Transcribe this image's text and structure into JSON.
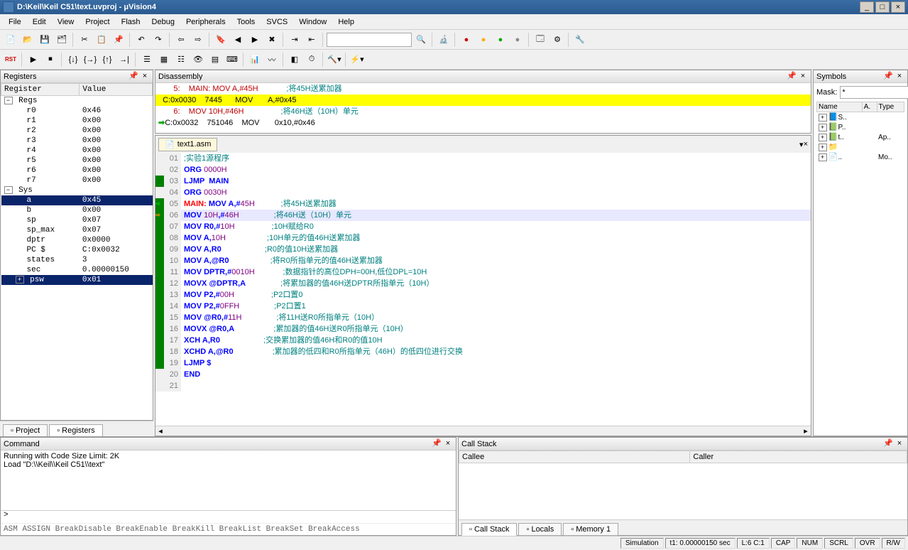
{
  "window": {
    "title": "D:\\Keil\\Keil C51\\text.uvproj - μVision4"
  },
  "menu": [
    "File",
    "Edit",
    "View",
    "Project",
    "Flash",
    "Debug",
    "Peripherals",
    "Tools",
    "SVCS",
    "Window",
    "Help"
  ],
  "panels": {
    "registers": "Registers",
    "disassembly": "Disassembly",
    "symbols": "Symbols",
    "command": "Command",
    "callstack": "Call Stack"
  },
  "registers": {
    "headers": [
      "Register",
      "Value"
    ],
    "groups": [
      {
        "name": "Regs",
        "expanded": true,
        "rows": [
          {
            "name": "r0",
            "value": "0x46"
          },
          {
            "name": "r1",
            "value": "0x00"
          },
          {
            "name": "r2",
            "value": "0x00"
          },
          {
            "name": "r3",
            "value": "0x00"
          },
          {
            "name": "r4",
            "value": "0x00"
          },
          {
            "name": "r5",
            "value": "0x00"
          },
          {
            "name": "r6",
            "value": "0x00"
          },
          {
            "name": "r7",
            "value": "0x00"
          }
        ]
      },
      {
        "name": "Sys",
        "expanded": true,
        "rows": [
          {
            "name": "a",
            "value": "0x45",
            "selected": true
          },
          {
            "name": "b",
            "value": "0x00"
          },
          {
            "name": "sp",
            "value": "0x07"
          },
          {
            "name": "sp_max",
            "value": "0x07"
          },
          {
            "name": "dptr",
            "value": "0x0000"
          },
          {
            "name": "PC $",
            "value": "C:0x0032"
          },
          {
            "name": "states",
            "value": "3"
          },
          {
            "name": "sec",
            "value": "0.00000150"
          },
          {
            "name": "psw",
            "value": "0x01",
            "expandable": true,
            "selected": true
          }
        ]
      }
    ]
  },
  "left_tabs": [
    {
      "label": "Project",
      "icon": "project-icon"
    },
    {
      "label": "Registers",
      "icon": "registers-icon",
      "active": true
    }
  ],
  "disassembly": [
    {
      "addr": "     5:",
      "label": " MAIN: MOV A,#45H",
      "cmt": ";将45H送累加器",
      "red": true
    },
    {
      "addr": "C:0x0030",
      "op": "7445",
      "mn": "MOV",
      "args": "A,#0x45",
      "hl": true
    },
    {
      "addr": "     6:",
      "label": " MOV 10H,#46H",
      "cmt": ";将46H送（10H）单元",
      "red": true
    },
    {
      "addr": "C:0x0032",
      "op": "751046",
      "mn": "MOV",
      "args": "0x10,#0x46",
      "marker": true
    }
  ],
  "editor": {
    "filename": "text1.asm",
    "lines": [
      {
        "n": "01",
        "txt": ";实验1源程序",
        "cmt_all": true,
        "mark": false
      },
      {
        "n": "02",
        "txt_parts": [
          {
            "t": "ORG ",
            "c": "kw"
          },
          {
            "t": "0000H",
            "c": "num"
          }
        ],
        "mark": false
      },
      {
        "n": "03",
        "txt_parts": [
          {
            "t": "LJMP  MAIN",
            "c": "kw"
          }
        ],
        "mark": true
      },
      {
        "n": "04",
        "txt_parts": [
          {
            "t": "ORG ",
            "c": "kw"
          },
          {
            "t": "0030H",
            "c": "num"
          }
        ],
        "mark": false
      },
      {
        "n": "05",
        "txt_parts": [
          {
            "t": "MAIN:",
            "c": "lbl"
          },
          {
            "t": " MOV A,#",
            "c": "kw"
          },
          {
            "t": "45H",
            "c": "num"
          }
        ],
        "cmt": ";将45H送累加器",
        "mark": true,
        "arrow": "green"
      },
      {
        "n": "06",
        "txt_parts": [
          {
            "t": "MOV ",
            "c": "kw"
          },
          {
            "t": "10H",
            "c": "num"
          },
          {
            "t": ",#",
            "c": "kw"
          },
          {
            "t": "46H",
            "c": "num"
          }
        ],
        "cmt": ";将46H送（10H）单元",
        "mark": true,
        "arrow": "yellow",
        "hl": true
      },
      {
        "n": "07",
        "txt_parts": [
          {
            "t": "MOV R0,#",
            "c": "kw"
          },
          {
            "t": "10H",
            "c": "num"
          }
        ],
        "cmt": ";10H赋给R0",
        "mark": true
      },
      {
        "n": "08",
        "txt_parts": [
          {
            "t": "MOV A,",
            "c": "kw"
          },
          {
            "t": "10H",
            "c": "num"
          }
        ],
        "cmt": ";10H单元的值46H送累加器",
        "mark": true
      },
      {
        "n": "09",
        "txt_parts": [
          {
            "t": "MOV A,R0",
            "c": "kw"
          }
        ],
        "cmt": ";R0的值10H送累加器",
        "mark": true
      },
      {
        "n": "10",
        "txt_parts": [
          {
            "t": "MOV A,@R0",
            "c": "kw"
          }
        ],
        "cmt": ";将R0所指单元的值46H送累加器",
        "mark": true
      },
      {
        "n": "11",
        "txt_parts": [
          {
            "t": "MOV DPTR,#",
            "c": "kw"
          },
          {
            "t": "0010H",
            "c": "num"
          }
        ],
        "cmt": ";数据指针的高位DPH=00H,低位DPL=10H",
        "mark": true
      },
      {
        "n": "12",
        "txt_parts": [
          {
            "t": "MOVX @DPTR,A",
            "c": "kw"
          }
        ],
        "cmt": ";将累加器的值46H送DPTR所指单元（10H）",
        "mark": true
      },
      {
        "n": "13",
        "txt_parts": [
          {
            "t": "MOV P2,#",
            "c": "kw"
          },
          {
            "t": "00H",
            "c": "num"
          }
        ],
        "cmt": ";P2口置0",
        "mark": true
      },
      {
        "n": "14",
        "txt_parts": [
          {
            "t": "MOV P2,#",
            "c": "kw"
          },
          {
            "t": "0FFH",
            "c": "num"
          }
        ],
        "cmt": ";P2口置1",
        "mark": true
      },
      {
        "n": "15",
        "txt_parts": [
          {
            "t": "MOV @R0,#",
            "c": "kw"
          },
          {
            "t": "11H",
            "c": "num"
          }
        ],
        "cmt": ";将11H送R0所指单元（10H）",
        "mark": true
      },
      {
        "n": "16",
        "txt_parts": [
          {
            "t": "MOVX @R0,A",
            "c": "kw"
          }
        ],
        "cmt": ";累加器的值46H送R0所指单元（10H）",
        "mark": true
      },
      {
        "n": "17",
        "txt_parts": [
          {
            "t": "XCH A,R0",
            "c": "kw"
          }
        ],
        "cmt": ";交换累加器的值46H和R0的值10H",
        "mark": true
      },
      {
        "n": "18",
        "txt_parts": [
          {
            "t": "XCHD A,@R0",
            "c": "kw"
          }
        ],
        "cmt": ";累加器的低四和R0所指单元（46H）的低四位进行交换",
        "mark": true
      },
      {
        "n": "19",
        "txt_parts": [
          {
            "t": "LJMP $",
            "c": "kw"
          }
        ],
        "mark": true
      },
      {
        "n": "20",
        "txt_parts": [
          {
            "t": "END",
            "c": "kw"
          }
        ],
        "mark": false
      },
      {
        "n": "21",
        "txt": "",
        "mark": false
      }
    ]
  },
  "symbols": {
    "mask_label": "Mask:",
    "mask_value": "*",
    "headers": [
      "Name",
      "A.",
      "Type"
    ],
    "rows": [
      {
        "icon": "📘",
        "name": "S..",
        "type": ""
      },
      {
        "icon": "📗",
        "name": "P..",
        "type": ""
      },
      {
        "icon": "📗",
        "name": "t..",
        "type": "Ap.."
      },
      {
        "icon": "📁",
        "name": "",
        "type": ""
      },
      {
        "icon": "📄",
        "name": "..",
        "type": "Mo.."
      }
    ]
  },
  "command": {
    "lines": [
      "Running with Code Size Limit: 2K",
      "Load \"D:\\\\Keil\\\\Keil C51\\\\text\""
    ],
    "prompt": ">",
    "hints": "ASM ASSIGN BreakDisable BreakEnable BreakKill BreakList BreakSet BreakAccess"
  },
  "callstack": {
    "headers": [
      "Callee",
      "Caller"
    ],
    "tabs": [
      "Call Stack",
      "Locals",
      "Memory 1"
    ]
  },
  "statusbar": {
    "mode": "Simulation",
    "time": "t1: 0.00000150 sec",
    "pos": "L:6 C:1",
    "flags": [
      "CAP",
      "NUM",
      "SCRL",
      "OVR",
      "R/W"
    ]
  }
}
